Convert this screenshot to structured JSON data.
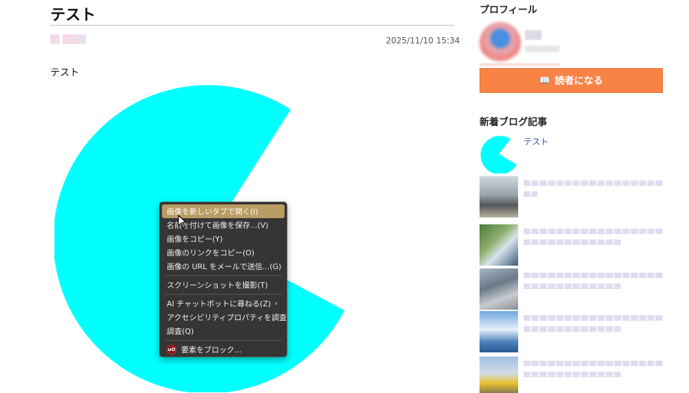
{
  "article": {
    "title": "テスト",
    "timestamp": "2025/11/10 15:34",
    "body": "テスト"
  },
  "sidebar": {
    "profile_heading": "プロフィール",
    "subscribe_label": "読者になる",
    "subscribe_icon": "book-icon",
    "subscribe_color": "#f98245",
    "recent_heading": "新着ブログ記事",
    "recent_first_title": "テスト"
  },
  "context_menu": {
    "items": [
      "画像を新しいタブで開く(I)",
      "名前を付けて画像を保存...(V)",
      "画像をコピー(Y)",
      "画像のリンクをコピー(O)",
      "画像の URL をメールで送信...(G)",
      "スクリーンショットを撮影(T)",
      "AI チャットボットに尋ねる(Z)",
      "アクセシビリティプロパティを調査",
      "調査(Q)",
      "要素をブロック..."
    ],
    "submenu_arrow": "›",
    "block_icon_text": "uO",
    "highlight_color": "#b89c63"
  },
  "colors": {
    "pacman": "#00ffff"
  }
}
